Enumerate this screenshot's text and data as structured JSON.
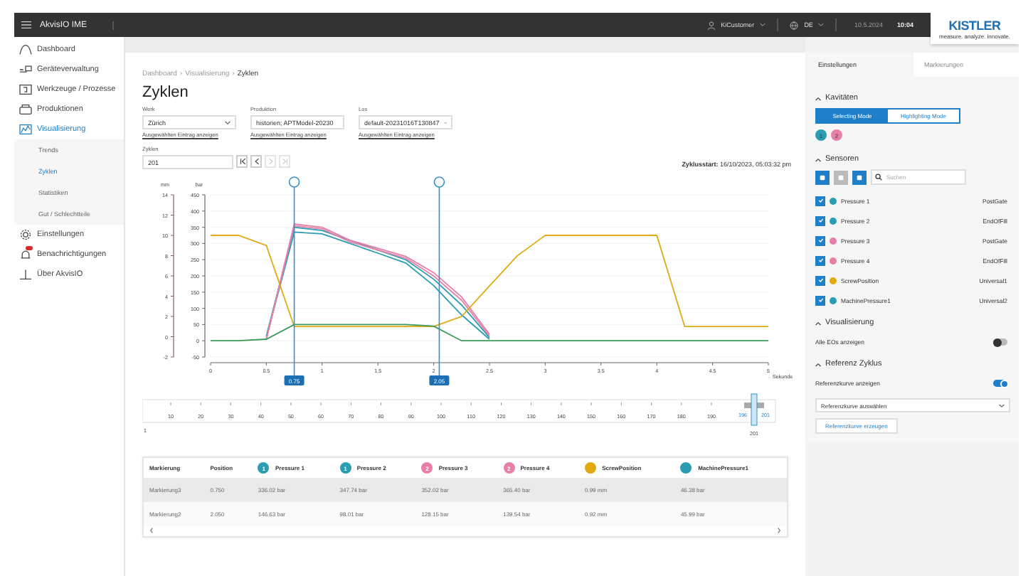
{
  "topbar": {
    "app_title": "AkvisIO IME",
    "user": "KiCustomer",
    "language": "DE",
    "date": "10.5.2024",
    "time": "10:04",
    "logo": "KISTLER",
    "tagline": "measure. analyze. innovate."
  },
  "sidebar": {
    "items": [
      {
        "label": "Dashboard",
        "selected": false
      },
      {
        "label": "Geräteverwaltung",
        "selected": false
      },
      {
        "label": "Werkzeuge / Prozesse",
        "selected": false
      },
      {
        "label": "Produktionen",
        "selected": false
      },
      {
        "label": "Visualisierung",
        "selected": true,
        "expanded": true,
        "children": [
          {
            "label": "Trends",
            "selected": false
          },
          {
            "label": "Zyklen",
            "selected": true
          },
          {
            "label": "Statistiken",
            "selected": false
          },
          {
            "label": "Gut / Schlechtteile",
            "selected": false
          }
        ]
      },
      {
        "label": "Einstellungen",
        "selected": false
      },
      {
        "label": "Benachrichtigungen",
        "selected": false,
        "alert": true
      },
      {
        "label": "Über AkvisIO",
        "selected": false
      }
    ]
  },
  "breadcrumb": [
    {
      "kind": "link",
      "text": "Dashboard"
    },
    {
      "kind": "separator",
      "text": "›"
    },
    {
      "kind": "link",
      "text": "Visualisierung"
    },
    {
      "kind": "separator",
      "text": "›"
    },
    {
      "kind": "current",
      "text": "Zyklen"
    }
  ],
  "title": "Zyklen",
  "filters": [
    {
      "label": "Werk",
      "value": "Zürich",
      "link": "Ausgewählten Eintrag anzeigen"
    },
    {
      "label": "Produktion",
      "value": "historien; APTModel-20230",
      "link": "Ausgewählten Eintrag anzeigen"
    },
    {
      "label": "Los",
      "value": "default-20231016T130847",
      "link": "Ausgewählten Eintrag anzeigen"
    }
  ],
  "cycles": {
    "label": "Zyklen",
    "value": "201",
    "nav": [
      {
        "kind": "first",
        "disabled": false
      },
      {
        "kind": "prev",
        "disabled": false
      },
      {
        "kind": "next",
        "disabled": true
      },
      {
        "kind": "last",
        "disabled": true
      }
    ],
    "start_label": "Zyklusstart:",
    "start_value": "16/10/2023, 05:03:32 pm"
  },
  "chart": {
    "chart_data": {
      "type": "line",
      "xlabel": "Sekunde",
      "ylabel": "bar",
      "y2label": "mm",
      "xlim": [
        0,
        5
      ],
      "ylim": [
        -50,
        450
      ],
      "y2lim": [
        -2,
        14
      ],
      "xticks": [
        0,
        0.5,
        1,
        1.5,
        2,
        2.5,
        3,
        3.5,
        4,
        4.5,
        5
      ],
      "yticks": [
        -50,
        0,
        50,
        100,
        150,
        200,
        250,
        300,
        350,
        400,
        450
      ],
      "y2ticks": [
        -2,
        0,
        2,
        4,
        6,
        8,
        10,
        12,
        14
      ],
      "x": [
        0,
        0.25,
        0.5,
        0.75,
        1,
        1.25,
        1.5,
        1.75,
        2,
        2.25,
        2.5,
        2.75,
        3,
        3.25,
        3.5,
        3.75,
        4,
        4.25,
        4.5,
        4.75,
        5
      ],
      "series": [
        {
          "color": "#2a9db5",
          "values": [
            null,
            null,
            10,
            335,
            330,
            300,
            270,
            240,
            170,
            80,
            5,
            null,
            null,
            null,
            null,
            null,
            null,
            null,
            null,
            null,
            null
          ]
        },
        {
          "color": "#2a9db5",
          "values": [
            null,
            null,
            15,
            350,
            340,
            310,
            280,
            250,
            190,
            110,
            10,
            null,
            null,
            null,
            null,
            null,
            null,
            null,
            null,
            null,
            null
          ]
        },
        {
          "color": "#e87fa8",
          "values": [
            null,
            null,
            5,
            360,
            350,
            310,
            285,
            260,
            210,
            135,
            20,
            null,
            null,
            null,
            null,
            null,
            null,
            null,
            null,
            null,
            null
          ]
        },
        {
          "color": "#e87fa8",
          "values": [
            null,
            null,
            5,
            355,
            345,
            305,
            280,
            255,
            200,
            125,
            15,
            null,
            null,
            null,
            null,
            null,
            null,
            null,
            null,
            null,
            null
          ]
        },
        {
          "color": "#e0aa10",
          "axis": "y2",
          "values": [
            10,
            10,
            9,
            1,
            1,
            1,
            1,
            1,
            1,
            2,
            5,
            8,
            10,
            10,
            10,
            10,
            10,
            1,
            1,
            1,
            1
          ]
        },
        {
          "color": "#3a9a5a",
          "values": [
            0,
            0,
            5,
            50,
            50,
            50,
            50,
            50,
            45,
            0,
            0,
            0,
            0,
            0,
            0,
            0,
            0,
            0,
            0,
            0,
            0
          ]
        }
      ],
      "grid": true,
      "ref_lines": [
        {
          "axis": "x",
          "value": 0.75,
          "label": "0.75"
        },
        {
          "axis": "x",
          "value": 2.05,
          "label": "2.05"
        }
      ]
    }
  },
  "range": {
    "start": "1",
    "end": "201",
    "ticks": [
      "10",
      "20",
      "30",
      "40",
      "50",
      "60",
      "70",
      "80",
      "90",
      "100",
      "110",
      "120",
      "130",
      "140",
      "150",
      "160",
      "170",
      "180",
      "190"
    ],
    "handle_from": "196",
    "handle_to": "201"
  },
  "table": {
    "columns": [
      {
        "label": "Markierung"
      },
      {
        "label": "Position"
      },
      {
        "label": "Pressure 1",
        "badge": "1",
        "color": "#2a9db5"
      },
      {
        "label": "Pressure 2",
        "badge": "1",
        "color": "#2a9db5"
      },
      {
        "label": "Pressure 3",
        "badge": "2",
        "color": "#e87fa8"
      },
      {
        "label": "Pressure 4",
        "badge": "2",
        "color": "#e87fa8"
      },
      {
        "label": "ScrewPosition",
        "color": "#e0aa10"
      },
      {
        "label": "MachinePressure1",
        "color": "#2a9db5"
      }
    ],
    "rows": [
      {
        "selected": true,
        "cells": [
          "Markierung3",
          "0.750",
          "336.02 bar",
          "347.74 bar",
          "352.02 bar",
          "365.40 bar",
          "0.99 mm",
          "46.38 bar"
        ]
      },
      {
        "selected": false,
        "cells": [
          "Markierung2",
          "2.050",
          "146.63 bar",
          "98.01 bar",
          "128.15 bar",
          "139.54 bar",
          "0.92 mm",
          "45.99 bar"
        ]
      }
    ]
  },
  "panel": {
    "tabs": [
      {
        "label": "Einstellungen",
        "selected": true
      },
      {
        "label": "Markierungen",
        "selected": false
      }
    ],
    "cavities": {
      "title": "Kavitäten",
      "expanded": true,
      "modes": [
        {
          "label": "Selecting Mode",
          "selected": true
        },
        {
          "label": "Highlighting Mode",
          "selected": false
        }
      ],
      "items": [
        {
          "label": "1",
          "color": "#2a9db5"
        },
        {
          "label": "2",
          "color": "#e87fa8"
        }
      ]
    },
    "sensors": {
      "title": "Sensoren",
      "expanded": true,
      "tools": [
        {
          "on": true
        },
        {
          "on": false
        },
        {
          "on": true
        }
      ],
      "search_placeholder": "Suchen",
      "items": [
        {
          "name": "Pressure 1",
          "type": "PostGate",
          "checked": true,
          "color": "#2a9db5"
        },
        {
          "name": "Pressure 2",
          "type": "EndOfFill",
          "checked": true,
          "color": "#2a9db5"
        },
        {
          "name": "Pressure 3",
          "type": "PostGate",
          "checked": true,
          "color": "#e87fa8"
        },
        {
          "name": "Pressure 4",
          "type": "EndOfFill",
          "checked": true,
          "color": "#e87fa8"
        },
        {
          "name": "ScrewPosition",
          "type": "Universal1",
          "checked": true,
          "color": "#e0aa10"
        },
        {
          "name": "MachinePressure1",
          "type": "Universal2",
          "checked": true,
          "color": "#2a9db5"
        }
      ]
    },
    "visualization": {
      "title": "Visualisierung",
      "expanded": true,
      "toggle_label": "Alle EOs anzeigen",
      "on": false
    },
    "reference": {
      "title": "Referenz Zyklus",
      "expanded": true,
      "toggle_label": "Referenzkurve anzeigen",
      "on": true,
      "select_placeholder": "Referenzkurve auswählen",
      "button": "Referenzkurve erzeugen"
    }
  }
}
